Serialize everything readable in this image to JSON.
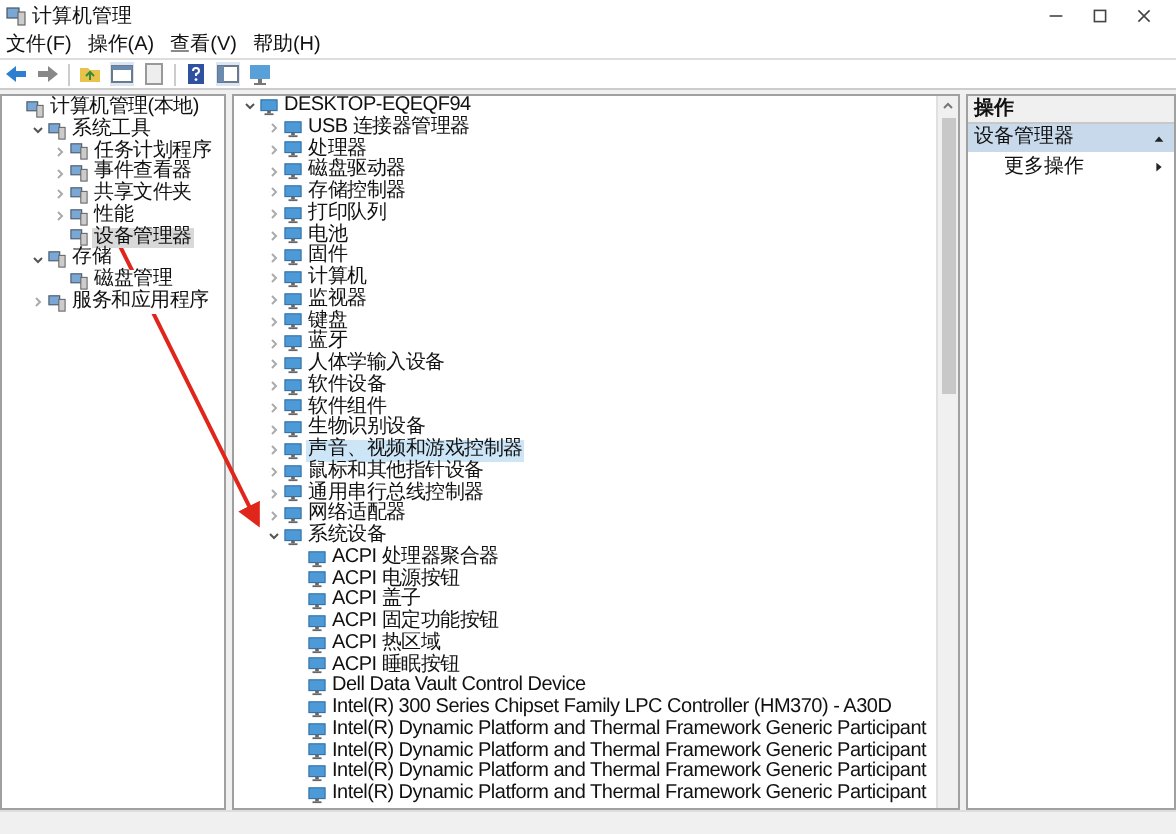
{
  "window": {
    "title": "计算机管理"
  },
  "menu": [
    "文件(F)",
    "操作(A)",
    "查看(V)",
    "帮助(H)"
  ],
  "navigation_tree": [
    {
      "label": "计算机管理(本地)",
      "selected": false,
      "children": [
        {
          "label": "系统工具",
          "expanded": true,
          "selected": false,
          "children": [
            {
              "label": "任务计划程序",
              "expanded": false,
              "selected": false
            },
            {
              "label": "事件查看器",
              "expanded": false,
              "selected": false
            },
            {
              "label": "共享文件夹",
              "expanded": false,
              "selected": false
            },
            {
              "label": "性能",
              "expanded": false,
              "selected": false
            },
            {
              "label": "设备管理器",
              "selected": true
            }
          ]
        },
        {
          "label": "存储",
          "expanded": true,
          "selected": false,
          "children": [
            {
              "label": "磁盘管理",
              "selected": false
            }
          ]
        },
        {
          "label": "服务和应用程序",
          "expanded": false,
          "selected": false
        }
      ]
    }
  ],
  "device_tree": [
    {
      "label": "DESKTOP-EQEQF94",
      "expanded": true,
      "selected": false,
      "children": [
        {
          "label": "USB 连接器管理器",
          "expanded": false,
          "selected": false
        },
        {
          "label": "处理器",
          "expanded": false,
          "selected": false
        },
        {
          "label": "磁盘驱动器",
          "expanded": false,
          "selected": false
        },
        {
          "label": "存储控制器",
          "expanded": false,
          "selected": false
        },
        {
          "label": "打印队列",
          "expanded": false,
          "selected": false
        },
        {
          "label": "电池",
          "expanded": false,
          "selected": false
        },
        {
          "label": "固件",
          "expanded": false,
          "selected": false
        },
        {
          "label": "计算机",
          "expanded": false,
          "selected": false
        },
        {
          "label": "监视器",
          "expanded": false,
          "selected": false
        },
        {
          "label": "键盘",
          "expanded": false,
          "selected": false
        },
        {
          "label": "蓝牙",
          "expanded": false,
          "selected": false
        },
        {
          "label": "人体学输入设备",
          "expanded": false,
          "selected": false
        },
        {
          "label": "软件设备",
          "expanded": false,
          "selected": false
        },
        {
          "label": "软件组件",
          "expanded": false,
          "selected": false
        },
        {
          "label": "生物识别设备",
          "expanded": false,
          "selected": false
        },
        {
          "label": "声音、视频和游戏控制器",
          "expanded": false,
          "selected": true
        },
        {
          "label": "鼠标和其他指针设备",
          "expanded": false,
          "selected": false
        },
        {
          "label": "通用串行总线控制器",
          "expanded": false,
          "selected": false
        },
        {
          "label": "网络适配器",
          "expanded": false,
          "selected": false
        },
        {
          "label": "系统设备",
          "expanded": true,
          "selected": false,
          "children": [
            {
              "label": "ACPI 处理器聚合器",
              "selected": false
            },
            {
              "label": "ACPI 电源按钮",
              "selected": false
            },
            {
              "label": "ACPI 盖子",
              "selected": false
            },
            {
              "label": "ACPI 固定功能按钮",
              "selected": false
            },
            {
              "label": "ACPI 热区域",
              "selected": false
            },
            {
              "label": "ACPI 睡眠按钮",
              "selected": false
            },
            {
              "label": "Dell Data Vault Control Device",
              "selected": false
            },
            {
              "label": "Intel(R) 300 Series Chipset Family LPC Controller (HM370) - A30D",
              "selected": false
            },
            {
              "label": "Intel(R) Dynamic Platform and Thermal Framework Generic Participant",
              "selected": false
            },
            {
              "label": "Intel(R) Dynamic Platform and Thermal Framework Generic Participant",
              "selected": false
            },
            {
              "label": "Intel(R) Dynamic Platform and Thermal Framework Generic Participant",
              "selected": false
            },
            {
              "label": "Intel(R) Dynamic Platform and Thermal Framework Generic Participant",
              "selected": false
            }
          ]
        }
      ]
    }
  ],
  "actions_pane": {
    "title": "操作",
    "section": {
      "label": "设备管理器",
      "expanded": true
    },
    "items": [
      {
        "label": "更多操作"
      }
    ]
  }
}
